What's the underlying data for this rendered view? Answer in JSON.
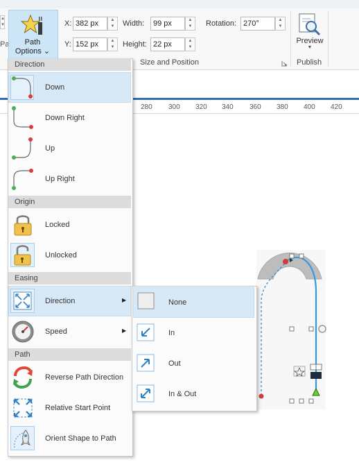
{
  "ribbon": {
    "left_cut_label": "Pat",
    "path_options": {
      "line1": "Path",
      "line2": "Options",
      "arrow": "⌄"
    },
    "fields": {
      "x_label": "X:",
      "x_value": "382 px",
      "y_label": "Y:",
      "y_value": "152 px",
      "width_label": "Width:",
      "width_value": "99 px",
      "height_label": "Height:",
      "height_value": "22 px",
      "rotation_label": "Rotation:",
      "rotation_value": "270°"
    },
    "size_position_group": "Size and Position",
    "preview_label": "Preview",
    "publish_group": "Publish"
  },
  "ruler": {
    "ticks": [
      "280",
      "300",
      "320",
      "340",
      "360",
      "380",
      "400",
      "420"
    ]
  },
  "menu": {
    "sections": {
      "direction": "Direction",
      "origin": "Origin",
      "easing": "Easing",
      "path": "Path"
    },
    "items": {
      "down": "Down",
      "down_right": "Down Right",
      "up": "Up",
      "up_right": "Up Right",
      "locked": "Locked",
      "unlocked": "Unlocked",
      "easing_direction": "Direction",
      "speed": "Speed",
      "reverse": "Reverse Path Direction",
      "relative_start": "Relative Start Point",
      "orient": "Orient Shape to Path"
    }
  },
  "submenu": {
    "none": "None",
    "in": "In",
    "out": "Out",
    "in_out": "In & Out"
  },
  "colors": {
    "accent": "#2e6fb3",
    "highlight": "#d7e8f7",
    "path_start": "#4caf50",
    "path_end": "#d93b3b"
  }
}
